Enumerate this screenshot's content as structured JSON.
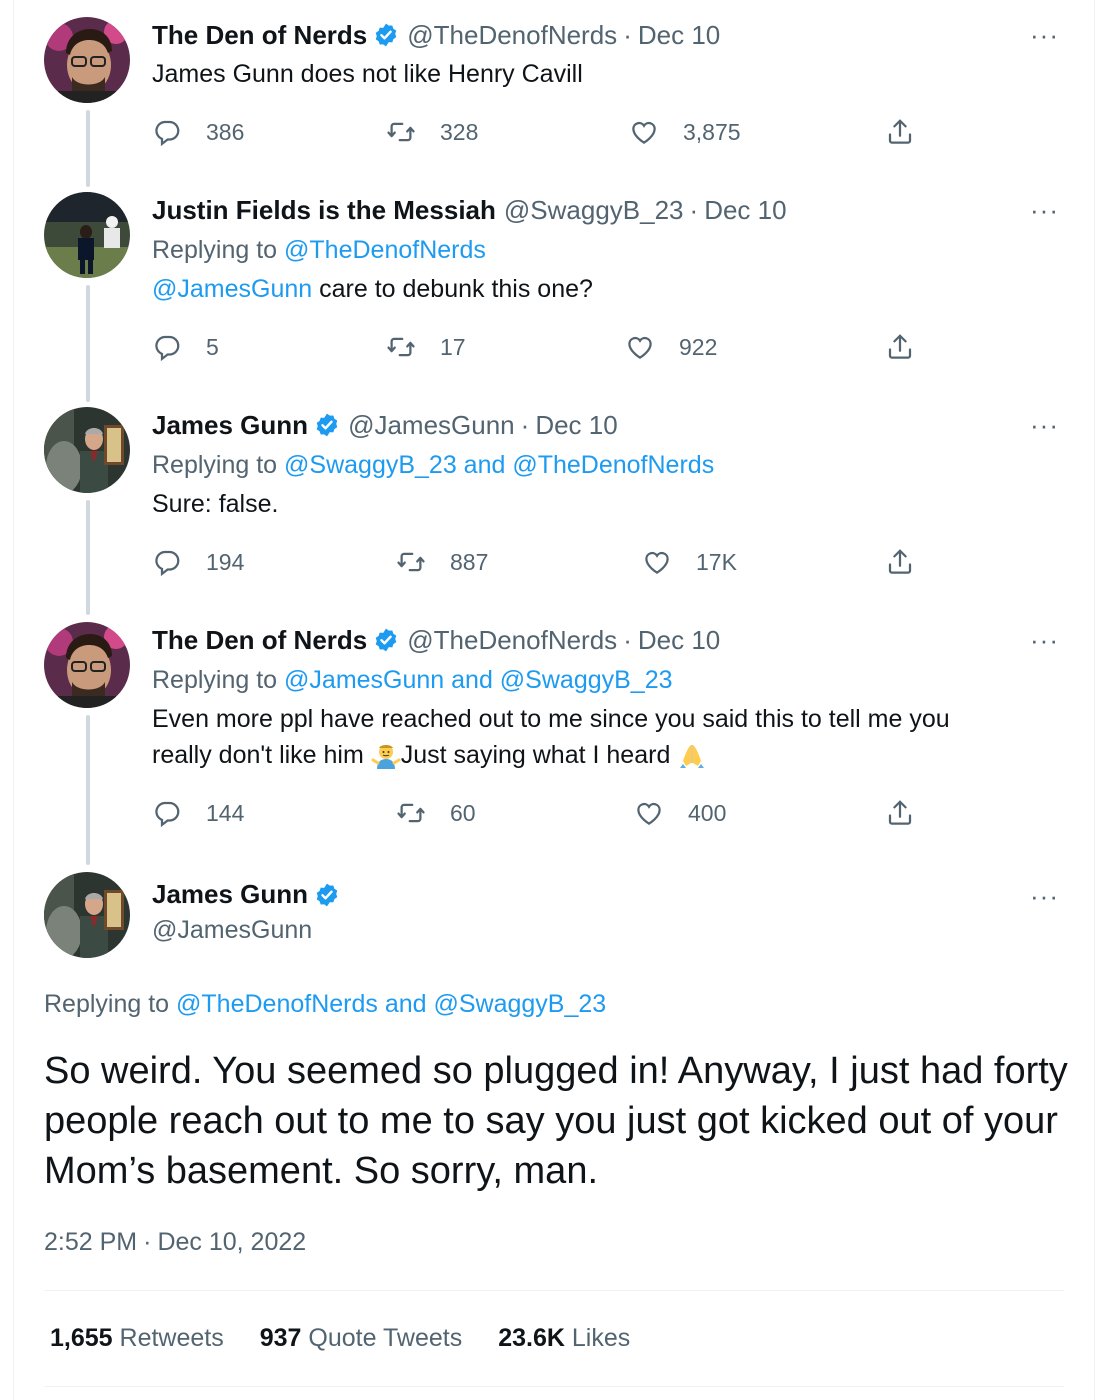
{
  "tweets": [
    {
      "name": "The Den of Nerds",
      "verified": true,
      "handle": "@TheDenofNerds",
      "date": "Dec 10",
      "reply_prefix": "",
      "reply_to": "",
      "text": "James Gunn does not like Henry Cavill",
      "replies": "386",
      "retweets": "328",
      "likes": "3,875"
    },
    {
      "name": "Justin Fields is the Messiah",
      "verified": false,
      "handle": "@SwaggyB_23",
      "date": "Dec 10",
      "reply_prefix": "Replying to ",
      "reply_to": "@TheDenofNerds",
      "mention": "@JamesGunn",
      "text": " care to debunk this one?",
      "replies": "5",
      "retweets": "17",
      "likes": "922"
    },
    {
      "name": "James Gunn",
      "verified": true,
      "handle": "@JamesGunn",
      "date": "Dec 10",
      "reply_prefix": "Replying to ",
      "reply_to": "@SwaggyB_23 and @TheDenofNerds",
      "text": "Sure: false.",
      "replies": "194",
      "retweets": "887",
      "likes": "17K"
    },
    {
      "name": "The Den of Nerds",
      "verified": true,
      "handle": "@TheDenofNerds",
      "date": "Dec 10",
      "reply_prefix": "Replying to ",
      "reply_to": "@JamesGunn and @SwaggyB_23",
      "text_line1": "Even more ppl have reached out to me since you said this to tell me you",
      "text_line2a": "really don't like him ",
      "text_line2b": "Just saying what I heard ",
      "emoji1": "man-shrugging-emoji",
      "emoji2": "folded-hands-emoji",
      "replies": "144",
      "retweets": "60",
      "likes": "400"
    }
  ],
  "sep": "·",
  "more": "···",
  "main_tweet": {
    "name": "James Gunn",
    "handle": "@JamesGunn",
    "reply_prefix": "Replying to ",
    "reply_to": "@TheDenofNerds and @SwaggyB_23",
    "text": "So weird. You seemed so plugged in! Anyway, I just had forty people reach out to me to say you just got kicked out of your Mom’s basement. So sorry, man.",
    "time": "2:52 PM",
    "date": "Dec 10, 2022",
    "retweets_count": "1,655",
    "retweets_label": "Retweets",
    "quotes_count": "937",
    "quotes_label": "Quote Tweets",
    "likes_count": "23.6K",
    "likes_label": "Likes"
  },
  "colors": {
    "link": "#1d9bf0",
    "secondary": "#536471",
    "text": "#0f1419",
    "thread_line": "#cfd9de"
  },
  "icons": [
    "reply-icon",
    "retweet-icon",
    "like-icon",
    "share-icon",
    "verified-badge-icon",
    "more-icon"
  ]
}
